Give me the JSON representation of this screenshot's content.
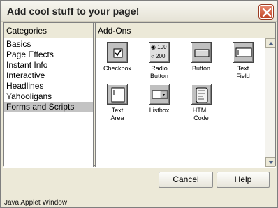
{
  "window": {
    "title": "Add cool stuff to your page!",
    "status_text": "Java Applet Window"
  },
  "categories": {
    "header": "Categories",
    "items": [
      {
        "label": "Basics"
      },
      {
        "label": "Page Effects"
      },
      {
        "label": "Instant Info"
      },
      {
        "label": "Interactive"
      },
      {
        "label": "Headlines"
      },
      {
        "label": "Yahooligans"
      },
      {
        "label": "Forms and Scripts",
        "selected": true
      }
    ]
  },
  "addons": {
    "header": "Add-Ons",
    "tools": [
      {
        "label": "Checkbox",
        "icon": "checkbox-icon"
      },
      {
        "label": "Radio\nButton",
        "icon": "radio-button-icon",
        "icon_text_a": "100",
        "icon_text_b": "200"
      },
      {
        "label": "Button",
        "icon": "button-icon"
      },
      {
        "label": "Text\nField",
        "icon": "text-field-icon"
      },
      {
        "label": "Text\nArea",
        "icon": "text-area-icon"
      },
      {
        "label": "Listbox",
        "icon": "listbox-icon"
      },
      {
        "label": "HTML\nCode",
        "icon": "html-code-icon"
      }
    ]
  },
  "buttons": {
    "cancel": "Cancel",
    "help": "Help"
  }
}
